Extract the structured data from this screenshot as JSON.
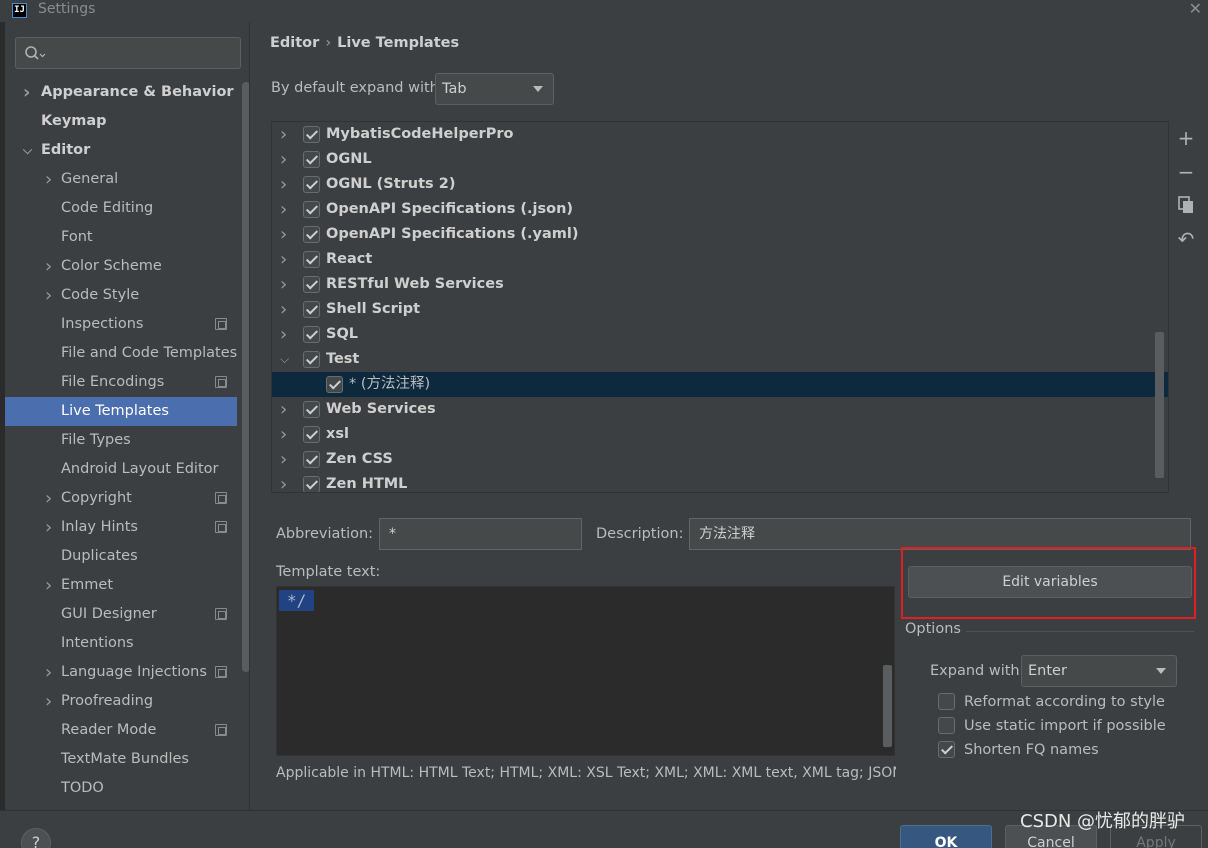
{
  "window": {
    "title": "Settings",
    "app_icon": "IJ"
  },
  "search": {
    "placeholder": "Q"
  },
  "sidebar": {
    "items": [
      {
        "label": "Appearance & Behavior",
        "chevron": "right",
        "bold": true,
        "indent": 0
      },
      {
        "label": "Keymap",
        "chevron": "",
        "bold": true,
        "indent": 0
      },
      {
        "label": "Editor",
        "chevron": "down",
        "bold": true,
        "indent": 0
      },
      {
        "label": "General",
        "chevron": "right",
        "indent": 1
      },
      {
        "label": "Code Editing",
        "chevron": "",
        "indent": 1
      },
      {
        "label": "Font",
        "chevron": "",
        "indent": 1
      },
      {
        "label": "Color Scheme",
        "chevron": "right",
        "indent": 1
      },
      {
        "label": "Code Style",
        "chevron": "right",
        "indent": 1
      },
      {
        "label": "Inspections",
        "chevron": "",
        "indent": 1,
        "project": true
      },
      {
        "label": "File and Code Templates",
        "chevron": "",
        "indent": 1
      },
      {
        "label": "File Encodings",
        "chevron": "",
        "indent": 1,
        "project": true
      },
      {
        "label": "Live Templates",
        "chevron": "",
        "indent": 1,
        "selected": true
      },
      {
        "label": "File Types",
        "chevron": "",
        "indent": 1
      },
      {
        "label": "Android Layout Editor",
        "chevron": "",
        "indent": 1
      },
      {
        "label": "Copyright",
        "chevron": "right",
        "indent": 1,
        "project": true
      },
      {
        "label": "Inlay Hints",
        "chevron": "right",
        "indent": 1,
        "project": true
      },
      {
        "label": "Duplicates",
        "chevron": "",
        "indent": 1
      },
      {
        "label": "Emmet",
        "chevron": "right",
        "indent": 1
      },
      {
        "label": "GUI Designer",
        "chevron": "",
        "indent": 1,
        "project": true
      },
      {
        "label": "Intentions",
        "chevron": "",
        "indent": 1
      },
      {
        "label": "Language Injections",
        "chevron": "right",
        "indent": 1,
        "project": true
      },
      {
        "label": "Proofreading",
        "chevron": "right",
        "indent": 1
      },
      {
        "label": "Reader Mode",
        "chevron": "",
        "indent": 1,
        "project": true
      },
      {
        "label": "TextMate Bundles",
        "chevron": "",
        "indent": 1
      },
      {
        "label": "TODO",
        "chevron": "",
        "indent": 1
      }
    ]
  },
  "breadcrumb": {
    "parent": "Editor",
    "separator": "›",
    "current": "Live Templates"
  },
  "expand": {
    "label": "By default expand with",
    "value": "Tab"
  },
  "templates": [
    {
      "label": "MybatisCodeHelperPro",
      "checked": true,
      "chevron": "right"
    },
    {
      "label": "OGNL",
      "checked": true,
      "chevron": "right"
    },
    {
      "label": "OGNL (Struts 2)",
      "checked": true,
      "chevron": "right"
    },
    {
      "label": "OpenAPI Specifications (.json)",
      "checked": true,
      "chevron": "right"
    },
    {
      "label": "OpenAPI Specifications (.yaml)",
      "checked": true,
      "chevron": "right"
    },
    {
      "label": "React",
      "checked": true,
      "chevron": "right"
    },
    {
      "label": "RESTful Web Services",
      "checked": true,
      "chevron": "right"
    },
    {
      "label": "Shell Script",
      "checked": true,
      "chevron": "right"
    },
    {
      "label": "SQL",
      "checked": true,
      "chevron": "right"
    },
    {
      "label": "Test",
      "checked": true,
      "chevron": "down"
    },
    {
      "label": "* (方法注释)",
      "checked": true,
      "chevron": "",
      "sub": true
    },
    {
      "label": "Web Services",
      "checked": true,
      "chevron": "right"
    },
    {
      "label": "xsl",
      "checked": true,
      "chevron": "right"
    },
    {
      "label": "Zen CSS",
      "checked": true,
      "chevron": "right"
    },
    {
      "label": "Zen HTML",
      "checked": true,
      "chevron": "right"
    }
  ],
  "side_toolbar": {
    "add": "+",
    "remove": "−",
    "copy_icon": "copy-icon",
    "revert": "↶"
  },
  "form": {
    "abbreviation_label": "Abbreviation:",
    "abbreviation_value": "*",
    "description_label": "Description:",
    "description_value": "方法注释",
    "template_text_label": "Template text:",
    "template_text_value": "*/",
    "edit_variables_label": "Edit variables",
    "applicable": "Applicable in HTML: HTML Text; HTML; XML: XSL Text; XML; XML: XML text, XML tag; JSON; J"
  },
  "options": {
    "title": "Options",
    "expand_label": "Expand with",
    "expand_value": "Enter",
    "reformat": {
      "label": "Reformat according to style",
      "checked": false
    },
    "static_import": {
      "label": "Use static import if possible",
      "checked": false
    },
    "shorten_fq": {
      "label": "Shorten FQ names",
      "checked": true
    }
  },
  "footer": {
    "help": "?",
    "ok": "OK",
    "cancel": "Cancel",
    "apply": "Apply"
  },
  "watermark": "CSDN @忧郁的胖驴",
  "colors": {
    "selection": "#4b6eaf",
    "ok_button": "#365880",
    "highlight": "#e02020"
  }
}
